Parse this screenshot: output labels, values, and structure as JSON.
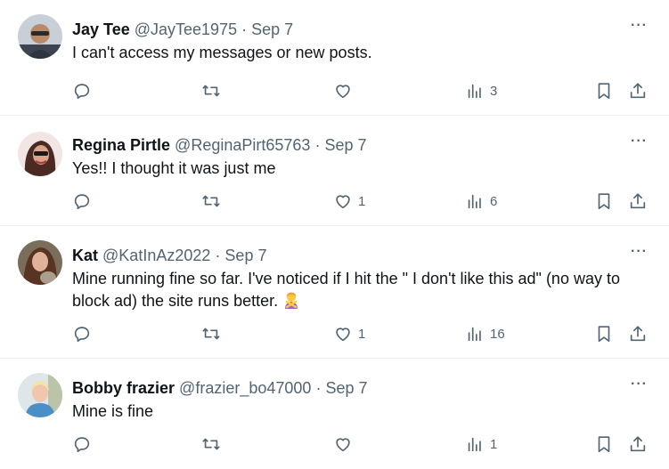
{
  "tweets": [
    {
      "name": "Jay Tee",
      "handle": "@JayTee1975",
      "separator": "·",
      "date": "Sep 7",
      "text": "I can't access my messages or new posts.",
      "likes": "",
      "views": "3"
    },
    {
      "name": "Regina Pirtle",
      "handle": "@ReginaPirt65763",
      "separator": "·",
      "date": "Sep 7",
      "text": "Yes!! I thought it was just me",
      "likes": "1",
      "views": "6"
    },
    {
      "name": "Kat",
      "handle": "@KatInAz2022",
      "separator": "·",
      "date": "Sep 7",
      "text": "Mine running fine so far. I've noticed if I hit the \" I don't like this ad\" (no way to block ad) the site runs better.",
      "emoji": "person-gesturing-no-emoji",
      "likes": "1",
      "views": "16"
    },
    {
      "name": "Bobby frazier",
      "handle": "@frazier_bo47000",
      "separator": "·",
      "date": "Sep 7",
      "text": "Mine is fine",
      "likes": "",
      "views": "1"
    }
  ],
  "more_label": "···",
  "icons": {
    "reply": "reply-icon",
    "retweet": "retweet-icon",
    "like": "heart-icon",
    "views": "views-icon",
    "bookmark": "bookmark-icon",
    "share": "share-icon"
  },
  "colors": {
    "text": "#0f1419",
    "muted": "#536471",
    "border": "#eff3f4"
  }
}
